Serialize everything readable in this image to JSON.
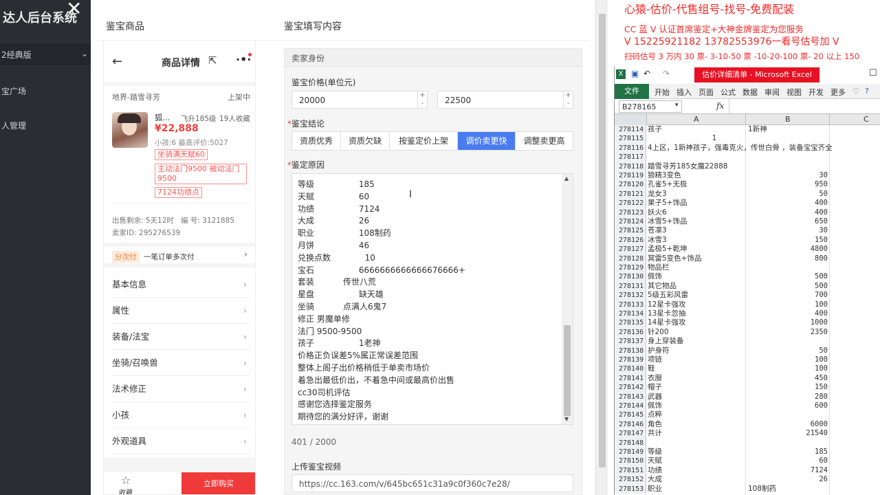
{
  "admin": {
    "title": "达人后台系统",
    "version": "2经典版",
    "nav": [
      "宝广场",
      "人管理"
    ]
  },
  "modal": {
    "left_title": "鉴宝商品",
    "right_title": "鉴宝填写内容"
  },
  "phone": {
    "header": "商品详情",
    "server": "地界-踏雪寻芳",
    "status": "上架中",
    "item_name": "狐...",
    "level_info": "飞升185级",
    "fav": "19人收藏",
    "price": "¥22,888",
    "kids": "小孩:6 最高评价:5027",
    "tags": [
      "坐骑满天赋60",
      "主动法门9500 被动法门9500",
      "7124功绩点"
    ],
    "sale_left": "出售剩余: 5天12时",
    "serial": "编 号: 3121885",
    "seller": "卖家ID: 295276539",
    "installment_badge": "分次付",
    "installment_text": "一笔订单多次付",
    "menu": [
      "基本信息",
      "属性",
      "装备/法宝",
      "坐骑/召唤兽",
      "法术修正",
      "小孩",
      "外观道具"
    ],
    "fav_label": "收藏",
    "buy_label": "立即购买"
  },
  "form": {
    "seller_section": "卖家身份",
    "price_label": "鉴宝价格(单位元)",
    "price_min": "20000",
    "price_max": "22500",
    "conclusion_label": "鉴宝结论",
    "conclusions": [
      "资质优秀",
      "资质欠缺",
      "按鉴定价上架",
      "调价卖更快",
      "调整卖更高"
    ],
    "active_conclusion": 3,
    "reason_label": "鉴定原因",
    "reason_lines": [
      "等级                 185",
      "天赋                 60",
      "功绩                 7124",
      "大成                 26",
      "职业                 108制药",
      "月饼                 46",
      "兑换点数             10",
      "宝石                 6666666666666676666+",
      "套装           传世八荒",
      "星盘                 缺天雄",
      "坐骑           点满人6鬼7",
      "修正 男魔单修",
      "法门 9500-9500",
      "孩子                 1老神",
      "价格正负误差5%属正常误差范围",
      "整体上阁子出价格稍低于单卖市场价",
      "着急出最低价出，不着急中间或最高价出售",
      "cc30司机评估",
      "感谢您选择鉴定服务",
      "期待您的满分好评，谢谢"
    ],
    "char_count": "401 / 2000",
    "video_label": "上传鉴宝视频",
    "video_url": "https://cc.163.com/v/645bc651c31a9c0f360c7e28/"
  },
  "ad": {
    "line1": "心猿-估价-代售组号-找号-免费配装",
    "line2": "CC 蓝 V 认证首席鉴定+大神金牌鉴定为您服务",
    "line3": "V 15225921182       13782553976一看号估号加 V",
    "line4": "扫码估号 3 万内 30 票- 3-10-50 票  -10-20-100 票- 20 以上 150"
  },
  "excel": {
    "title": "估价详细清单 - Microsoft Excel",
    "tabs": [
      "文件",
      "开始",
      "插入",
      "页面",
      "公式",
      "数据",
      "审阅",
      "视图",
      "开发",
      "更多"
    ],
    "cell_ref": "B278165",
    "col_headers": [
      "A",
      "B",
      "C"
    ],
    "rows": [
      {
        "n": "278114",
        "a": "孩子",
        "b": "1新神",
        "bt": true
      },
      {
        "n": "278115",
        "a": "",
        "b": "1",
        "bt": false,
        "mid": true
      },
      {
        "n": "278116",
        "a": "4上区，1新神孩子，强毒克火，传世白骨 ，装备宝宝齐全",
        "b": ""
      },
      {
        "n": "278117",
        "a": "",
        "b": ""
      },
      {
        "n": "278118",
        "a": "踏雪寻芳185女魔22888",
        "b": ""
      },
      {
        "n": "278119",
        "a": "狼精3变色",
        "b": "30"
      },
      {
        "n": "278120",
        "a": "孔雀5+无极",
        "b": "950"
      },
      {
        "n": "278121",
        "a": "龙女3",
        "b": "50"
      },
      {
        "n": "278122",
        "a": "果子5+饰品",
        "b": "400"
      },
      {
        "n": "278123",
        "a": "妖火6",
        "b": "400"
      },
      {
        "n": "278124",
        "a": "冰雪5+饰品",
        "b": "650"
      },
      {
        "n": "278125",
        "a": "苍凛3",
        "b": "30"
      },
      {
        "n": "278126",
        "a": "冰雪3",
        "b": "150"
      },
      {
        "n": "278127",
        "a": "孟极5+乾坤",
        "b": "4800"
      },
      {
        "n": "278128",
        "a": "冥雷5变色+饰品",
        "b": "800"
      },
      {
        "n": "278129",
        "a": "物品栏",
        "b": ""
      },
      {
        "n": "278130",
        "a": "佩饰",
        "b": "500"
      },
      {
        "n": "278131",
        "a": "其它物品",
        "b": "500"
      },
      {
        "n": "278132",
        "a": "5级五彩风雷",
        "b": "700"
      },
      {
        "n": "278133",
        "a": "12星卡强攻",
        "b": "100"
      },
      {
        "n": "278134",
        "a": "13星卡忽抽",
        "b": "400"
      },
      {
        "n": "278135",
        "a": "14星卡强攻",
        "b": "1000"
      },
      {
        "n": "278136",
        "a": "针200",
        "b": "2350"
      },
      {
        "n": "278137",
        "a": "身上穿装备",
        "b": ""
      },
      {
        "n": "278138",
        "a": "护身符",
        "b": "50"
      },
      {
        "n": "278139",
        "a": "项链",
        "b": "100"
      },
      {
        "n": "278140",
        "a": "鞋",
        "b": "100"
      },
      {
        "n": "278141",
        "a": "衣服",
        "b": "450"
      },
      {
        "n": "278142",
        "a": "帽子",
        "b": "150"
      },
      {
        "n": "278143",
        "a": "武器",
        "b": "280"
      },
      {
        "n": "278144",
        "a": "佩饰",
        "b": "600"
      },
      {
        "n": "278145",
        "a": "点粹",
        "b": ""
      },
      {
        "n": "278146",
        "a": "角色",
        "b": "6000"
      },
      {
        "n": "278147",
        "a": "共计",
        "b": "21540"
      },
      {
        "n": "278148",
        "a": "",
        "b": ""
      },
      {
        "n": "278149",
        "a": "等级",
        "b": "185"
      },
      {
        "n": "278150",
        "a": "天赋",
        "b": "60"
      },
      {
        "n": "278151",
        "a": "功绩",
        "b": "7124"
      },
      {
        "n": "278152",
        "a": "大成",
        "b": "26"
      },
      {
        "n": "278153",
        "a": "职业",
        "b": "108制药",
        "bt": true
      }
    ]
  }
}
